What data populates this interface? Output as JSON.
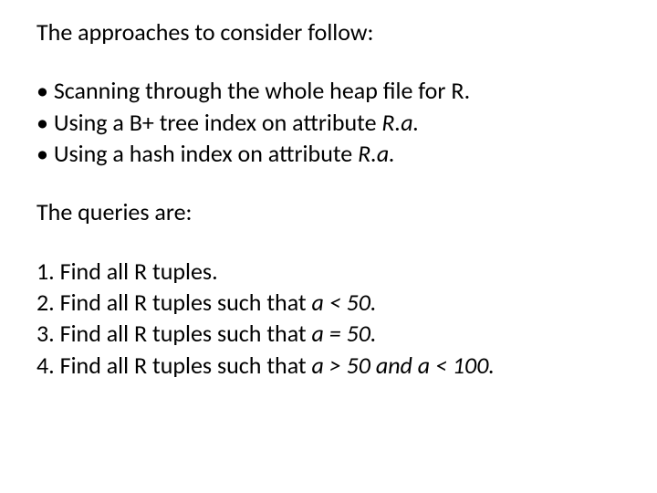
{
  "intro": "The approaches to consider follow:",
  "approaches": {
    "b1": "• Scanning through the whole heap file for R.",
    "b2_pre": "• Using a B+ tree index on attribute ",
    "b2_it": "R.a.",
    "b3_pre": "• Using a hash index on attribute ",
    "b3_it": "R.a."
  },
  "queries_intro": "The queries are:",
  "queries": {
    "q1": "1. Find all R tuples.",
    "q2_pre": "2. Find all R tuples such that ",
    "q2_it": "a < 50.",
    "q3_pre": "3. Find all R tuples such that ",
    "q3_it": "a = 50.",
    "q4_pre": "4. Find all R tuples such that ",
    "q4_it": "a > 50 and a < 100."
  }
}
